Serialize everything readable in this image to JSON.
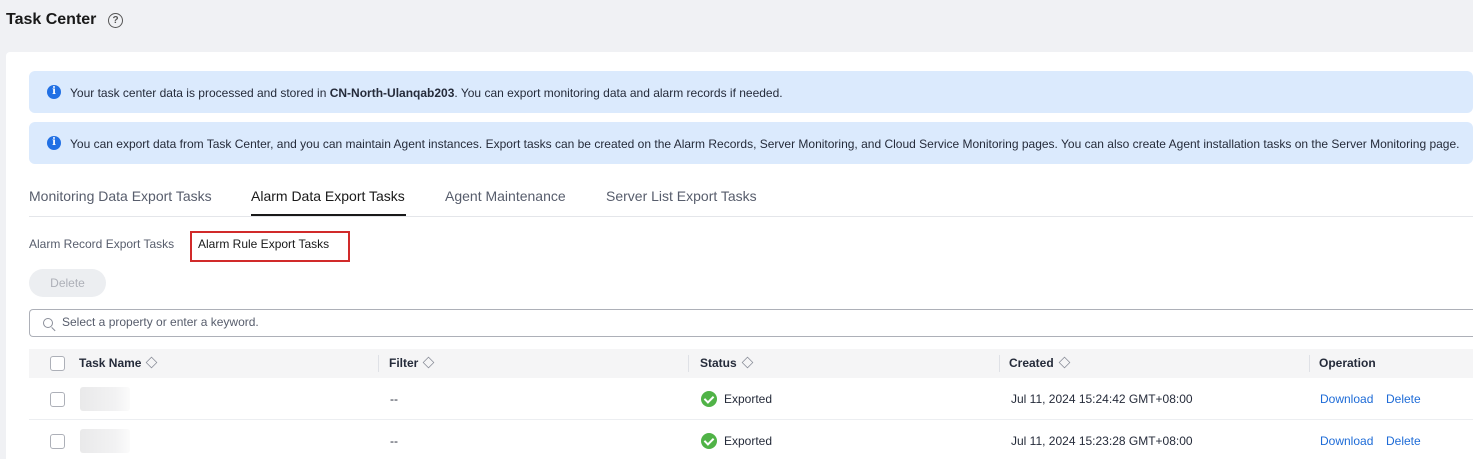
{
  "header": {
    "title": "Task Center",
    "help_icon": "question-circle-icon"
  },
  "notices": [
    {
      "icon": "info-icon",
      "prefix": "Your task center data is processed and stored in ",
      "bold": "CN-North-Ulanqab203",
      "suffix": ". You can export monitoring data and alarm records if needed."
    },
    {
      "icon": "info-icon",
      "text": "You can export data from Task Center, and you can maintain Agent instances. Export tasks can be created on the Alarm Records, Server Monitoring, and Cloud Service Monitoring pages. You can also create Agent installation tasks on the Server Monitoring page."
    }
  ],
  "tabs": [
    {
      "label": "Monitoring Data Export Tasks",
      "active": false
    },
    {
      "label": "Alarm Data Export Tasks",
      "active": true
    },
    {
      "label": "Agent Maintenance",
      "active": false
    },
    {
      "label": "Server List Export Tasks",
      "active": false
    }
  ],
  "subtabs": [
    {
      "label": "Alarm Record Export Tasks",
      "active": false
    },
    {
      "label": "Alarm Rule Export Tasks",
      "active": true
    }
  ],
  "toolbar": {
    "delete_label": "Delete",
    "delete_disabled": true
  },
  "search": {
    "placeholder": "Select a property or enter a keyword."
  },
  "table": {
    "columns": [
      "Task Name",
      "Filter",
      "Status",
      "Created",
      "Operation"
    ],
    "rows": [
      {
        "task_name": "",
        "filter": "--",
        "status": "Exported",
        "created": "Jul 11, 2024 15:24:42 GMT+08:00",
        "actions": [
          "Download",
          "Delete"
        ]
      },
      {
        "task_name": "",
        "filter": "--",
        "status": "Exported",
        "created": "Jul 11, 2024 15:23:28 GMT+08:00",
        "actions": [
          "Download",
          "Delete"
        ]
      }
    ]
  },
  "colors": {
    "accent": "#1d6bd7",
    "info": "#2170e4",
    "success": "#50b347",
    "highlight_border": "#d12a2a",
    "notice_bg": "#dbeafd"
  }
}
